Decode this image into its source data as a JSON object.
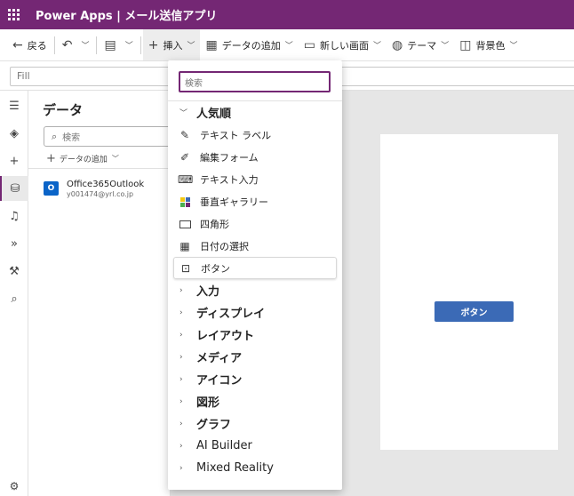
{
  "titlebar": {
    "app_title": "Power Apps  |  メール送信アプリ"
  },
  "cmdbar": {
    "back": "戻る",
    "undo_icon": "undo-icon",
    "insert": "挿入",
    "add_data": "データの追加",
    "new_screen": "新しい画面",
    "theme": "テーマ",
    "background": "背景色"
  },
  "formula": {
    "property": "Fill"
  },
  "panel": {
    "title": "データ",
    "search_placeholder": "検索",
    "add_data": "データの追加",
    "connection": {
      "name": "Office365Outlook",
      "email": "y001474@yrl.co.jp"
    }
  },
  "dropdown": {
    "search_placeholder": "検索",
    "popular_group": "人気順",
    "items": [
      {
        "label": "テキスト ラベル",
        "icon": "edit-icon"
      },
      {
        "label": "編集フォーム",
        "icon": "form-icon"
      },
      {
        "label": "テキスト入力",
        "icon": "text-input-icon"
      },
      {
        "label": "垂直ギャラリー",
        "icon": "gallery-icon"
      },
      {
        "label": "四角形",
        "icon": "rectangle-icon"
      },
      {
        "label": "日付の選択",
        "icon": "calendar-icon"
      },
      {
        "label": "ボタン",
        "icon": "button-icon"
      }
    ],
    "groups": [
      "入力",
      "ディスプレイ",
      "レイアウト",
      "メディア",
      "アイコン",
      "図形",
      "グラフ",
      "AI Builder",
      "Mixed Reality"
    ]
  },
  "canvas": {
    "button_label": "ボタン"
  },
  "colors": {
    "brand": "#742774",
    "button": "#3b6ab6"
  }
}
